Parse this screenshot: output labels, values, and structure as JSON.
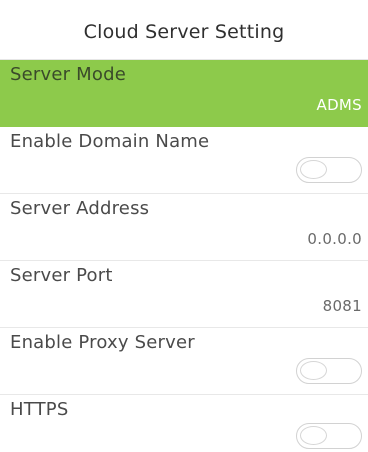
{
  "header": {
    "title": "Cloud Server Setting"
  },
  "settings": [
    {
      "label": "Server Mode",
      "value": "ADMS",
      "kind": "value",
      "selected": true
    },
    {
      "label": "Enable Domain Name",
      "value": "",
      "kind": "toggle",
      "checked": false
    },
    {
      "label": "Server Address",
      "value": "0.0.0.0",
      "kind": "value"
    },
    {
      "label": "Server Port",
      "value": "8081",
      "kind": "value"
    },
    {
      "label": "Enable Proxy Server",
      "value": "",
      "kind": "toggle",
      "checked": false
    },
    {
      "label": "HTTPS",
      "value": "",
      "kind": "toggle",
      "checked": false
    }
  ],
  "colors": {
    "selected_row": "#8dca4b",
    "text": "#4a4a4a",
    "background": "#ffffff"
  }
}
